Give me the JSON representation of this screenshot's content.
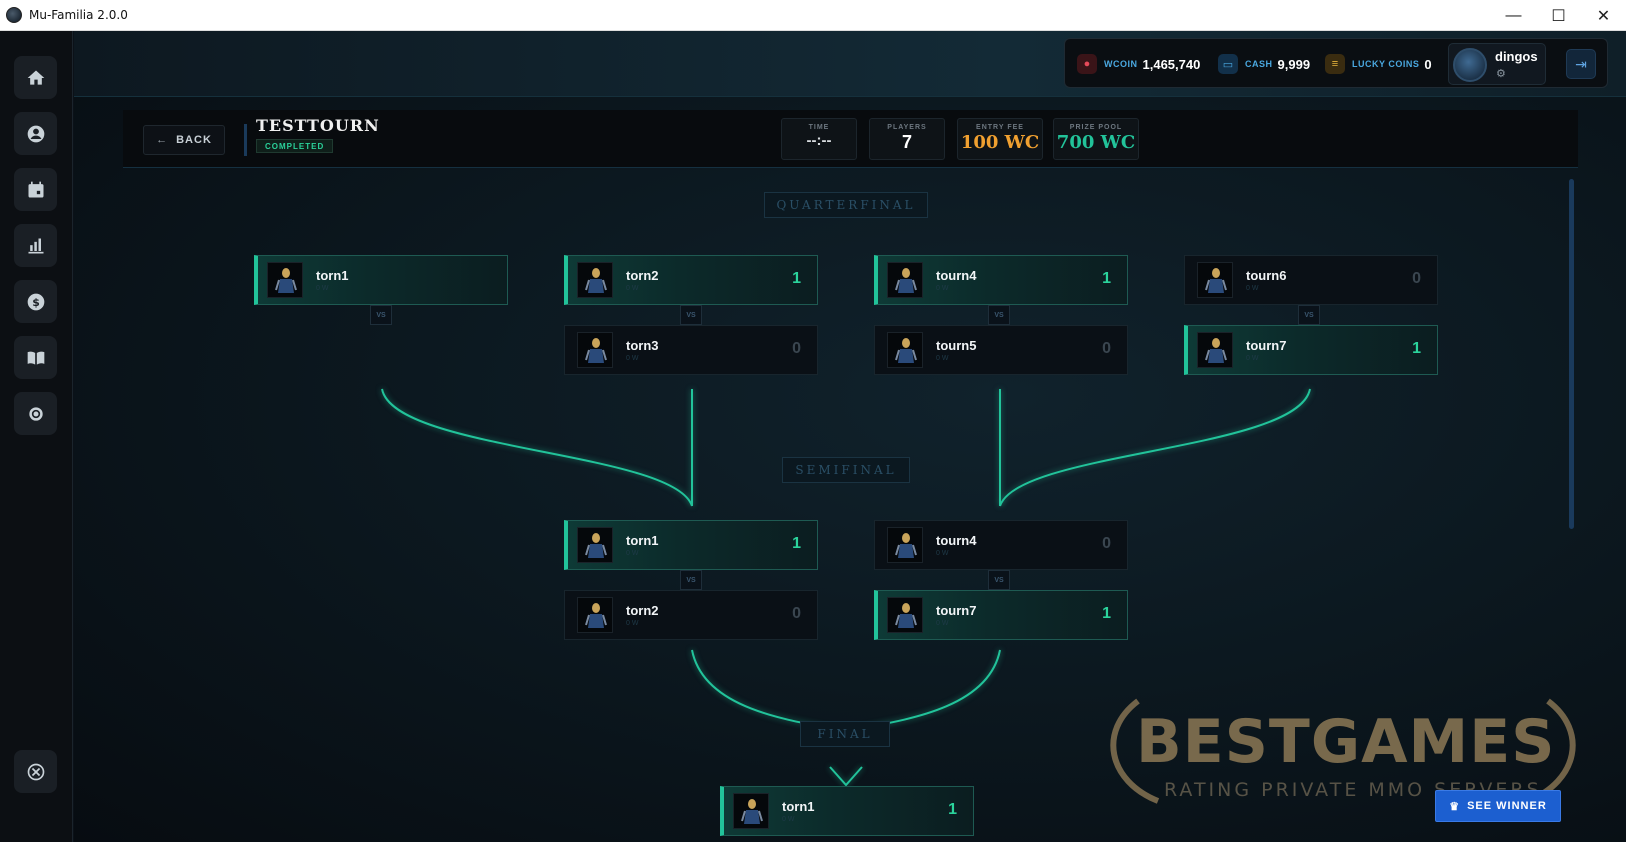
{
  "window": {
    "title": "Mu-Familia 2.0.0",
    "minimize": "—",
    "maximize": "☐",
    "close": "✕"
  },
  "sidebar": {
    "items": [
      {
        "name": "home-icon"
      },
      {
        "name": "profile-icon"
      },
      {
        "name": "calendar-icon"
      },
      {
        "name": "stats-icon"
      },
      {
        "name": "dollar-icon"
      },
      {
        "name": "book-icon"
      },
      {
        "name": "target-icon"
      }
    ],
    "bottom": {
      "name": "close-circle-icon"
    }
  },
  "topbar": {
    "wcoin_label": "WCOIN",
    "wcoin_value": "1,465,740",
    "cash_label": "CASH",
    "cash_value": "9,999",
    "lucky_label": "LUCKY COINS",
    "lucky_value": "0",
    "username": "dingos",
    "colors": {
      "wcoin": "#e64a5a",
      "cash": "#4aa8e0",
      "lucky": "#e6b43c"
    }
  },
  "tournament": {
    "back_label": "BACK",
    "name": "TESTTOURN",
    "status": "COMPLETED",
    "stats": {
      "time_label": "TIME",
      "time_value": "--:--",
      "players_label": "PLAYERS",
      "players_value": "7",
      "entry_label": "ENTRY FEE",
      "entry_value": "100 WC",
      "prize_label": "PRIZE POOL",
      "prize_value": "700 WC"
    },
    "accent": "#22c39a"
  },
  "bracket": {
    "rounds": {
      "quarterfinal": "QUARTERFINAL",
      "semifinal": "SEMIFINAL",
      "final": "FINAL"
    },
    "vs_label": "VS",
    "quarterfinal": [
      {
        "top": {
          "name": "torn1",
          "sub": "0 W",
          "score": ""
        },
        "bottom": null
      },
      {
        "top": {
          "name": "torn2",
          "sub": "0 W",
          "score": "1"
        },
        "bottom": {
          "name": "torn3",
          "sub": "0 W",
          "score": "0"
        }
      },
      {
        "top": {
          "name": "tourn4",
          "sub": "0 W",
          "score": "1"
        },
        "bottom": {
          "name": "tourn5",
          "sub": "0 W",
          "score": "0"
        }
      },
      {
        "top": {
          "name": "tourn6",
          "sub": "0 W",
          "score": "0"
        },
        "bottom": {
          "name": "tourn7",
          "sub": "0 W",
          "score": "1"
        }
      }
    ],
    "semifinal": [
      {
        "top": {
          "name": "torn1",
          "sub": "0 W",
          "score": "1"
        },
        "bottom": {
          "name": "torn2",
          "sub": "0 W",
          "score": "0"
        }
      },
      {
        "top": {
          "name": "tourn4",
          "sub": "0 W",
          "score": "0"
        },
        "bottom": {
          "name": "tourn7",
          "sub": "0 W",
          "score": "1"
        }
      }
    ],
    "final": [
      {
        "top": {
          "name": "torn1",
          "sub": "0 W",
          "score": "1"
        }
      }
    ]
  },
  "watermark": {
    "title": "BESTGAMES",
    "subtitle": "RATING PRIVATE MMO SERVERS"
  },
  "see_winner_label": "SEE WINNER"
}
